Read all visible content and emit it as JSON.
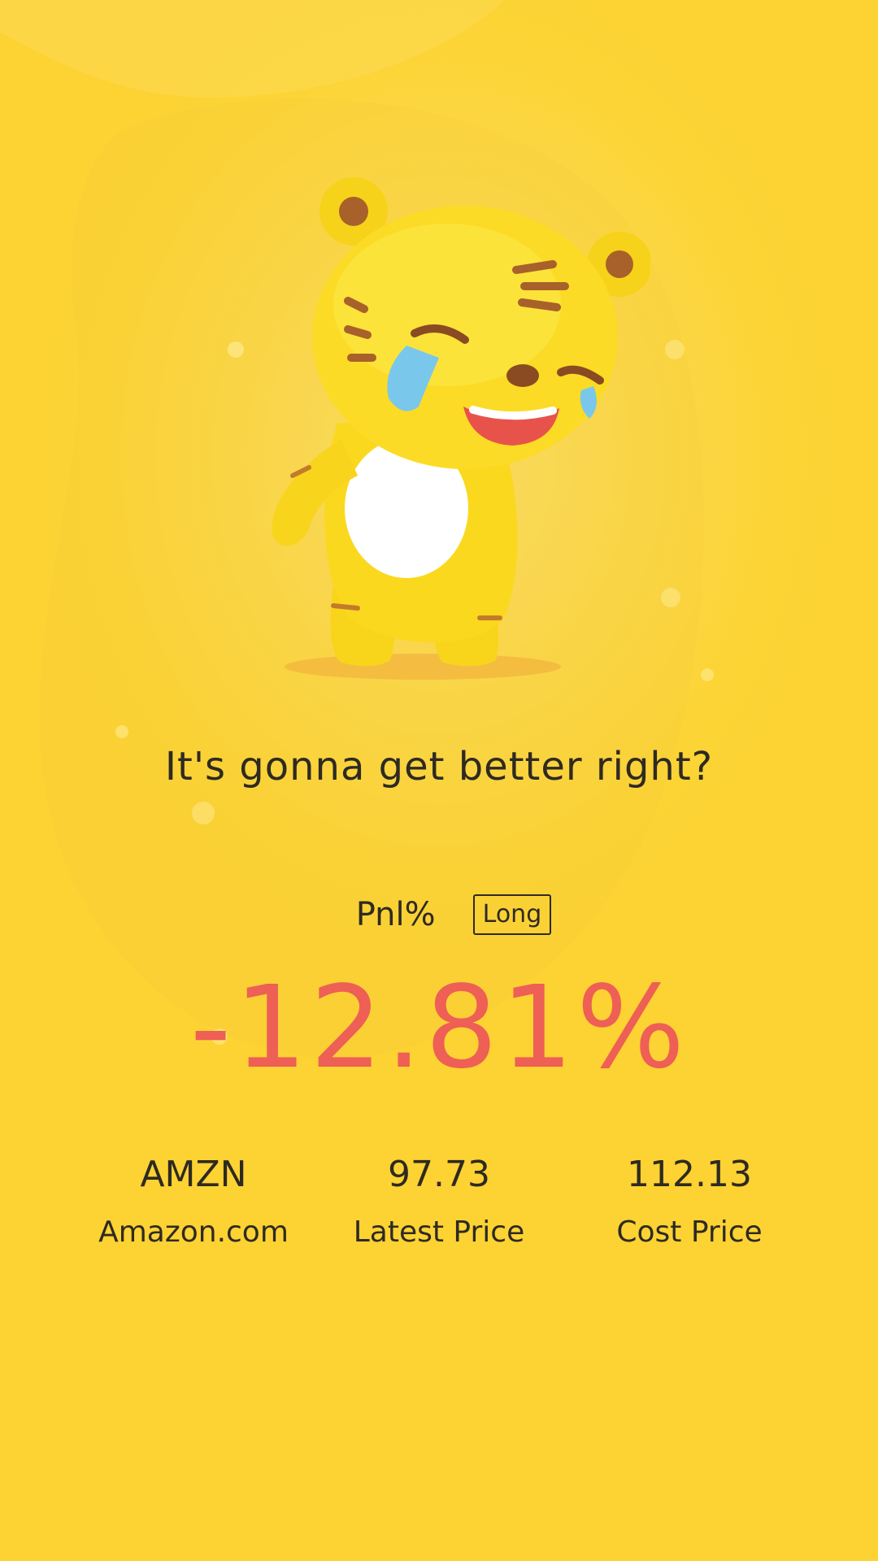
{
  "message": {
    "text": "It's gonna get better right?"
  },
  "pnl": {
    "label": "Pnl%",
    "direction": "Long",
    "value": "-12.81%",
    "value_color": "#ee5f55"
  },
  "stats": {
    "symbol": "AMZN",
    "company": "Amazon.com",
    "latest_price": "97.73",
    "latest_price_label": "Latest Price",
    "cost_price": "112.13",
    "cost_price_label": "Cost Price"
  },
  "illustration": {
    "icon": "crying-tiger-mascot-icon"
  },
  "theme": {
    "background": "#fcd435",
    "text": "#2e2a22"
  }
}
